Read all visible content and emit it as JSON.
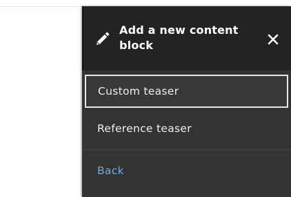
{
  "tray": {
    "title": "Add a new content block",
    "close_icon": "close-icon",
    "title_icon": "pencil-icon"
  },
  "menu": {
    "items": [
      {
        "label": "Custom teaser",
        "selected": true
      },
      {
        "label": "Reference teaser",
        "selected": false
      }
    ],
    "back_label": "Back"
  },
  "colors": {
    "tray_bg": "#333333",
    "header_bg": "#232323",
    "text": "#ffffff",
    "link": "#72a9e8",
    "selected_border": "#e8e8e8"
  }
}
